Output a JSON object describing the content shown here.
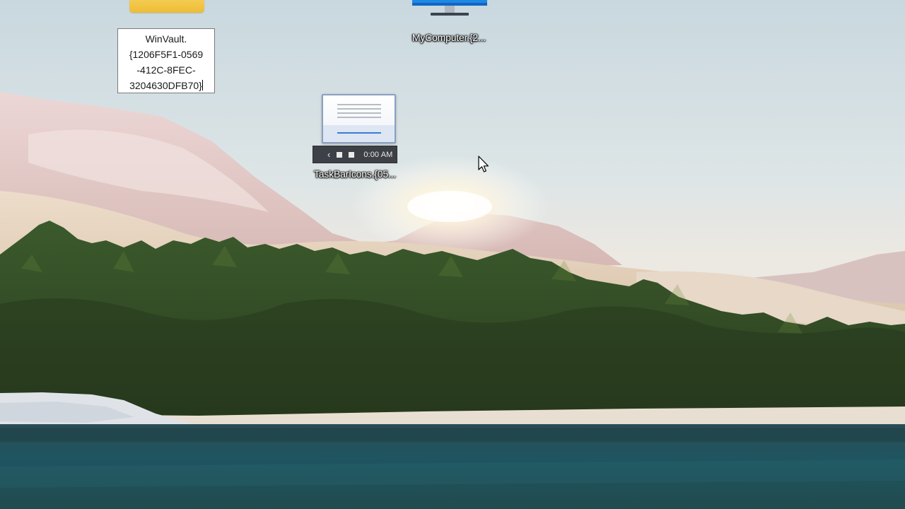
{
  "desktop": {
    "icons": [
      {
        "id": "winvault-folder",
        "label": "",
        "rename_value": "WinVault.\n{1206F5F1-0569\n-412C-8FEC-\n3204630DFB70}"
      },
      {
        "id": "mycomputer",
        "label": "MyComputer.{2..."
      },
      {
        "id": "taskbaricons",
        "label": "TaskBarIcons.{05...",
        "preview_time": "0:00 AM",
        "preview_back_glyph": "‹"
      }
    ]
  },
  "colors": {
    "folder": "#eebc34",
    "monitor_screen": "#1e88e5",
    "water": "#1e4a50",
    "sky": "#dfe7ea"
  }
}
